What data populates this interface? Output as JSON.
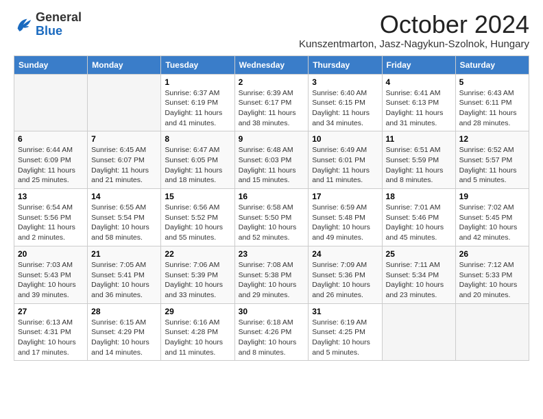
{
  "logo": {
    "general": "General",
    "blue": "Blue"
  },
  "header": {
    "title": "October 2024",
    "location": "Kunszentmarton, Jasz-Nagykun-Szolnok, Hungary"
  },
  "days_of_week": [
    "Sunday",
    "Monday",
    "Tuesday",
    "Wednesday",
    "Thursday",
    "Friday",
    "Saturday"
  ],
  "weeks": [
    [
      {
        "day": "",
        "info": ""
      },
      {
        "day": "",
        "info": ""
      },
      {
        "day": "1",
        "info": "Sunrise: 6:37 AM\nSunset: 6:19 PM\nDaylight: 11 hours and 41 minutes."
      },
      {
        "day": "2",
        "info": "Sunrise: 6:39 AM\nSunset: 6:17 PM\nDaylight: 11 hours and 38 minutes."
      },
      {
        "day": "3",
        "info": "Sunrise: 6:40 AM\nSunset: 6:15 PM\nDaylight: 11 hours and 34 minutes."
      },
      {
        "day": "4",
        "info": "Sunrise: 6:41 AM\nSunset: 6:13 PM\nDaylight: 11 hours and 31 minutes."
      },
      {
        "day": "5",
        "info": "Sunrise: 6:43 AM\nSunset: 6:11 PM\nDaylight: 11 hours and 28 minutes."
      }
    ],
    [
      {
        "day": "6",
        "info": "Sunrise: 6:44 AM\nSunset: 6:09 PM\nDaylight: 11 hours and 25 minutes."
      },
      {
        "day": "7",
        "info": "Sunrise: 6:45 AM\nSunset: 6:07 PM\nDaylight: 11 hours and 21 minutes."
      },
      {
        "day": "8",
        "info": "Sunrise: 6:47 AM\nSunset: 6:05 PM\nDaylight: 11 hours and 18 minutes."
      },
      {
        "day": "9",
        "info": "Sunrise: 6:48 AM\nSunset: 6:03 PM\nDaylight: 11 hours and 15 minutes."
      },
      {
        "day": "10",
        "info": "Sunrise: 6:49 AM\nSunset: 6:01 PM\nDaylight: 11 hours and 11 minutes."
      },
      {
        "day": "11",
        "info": "Sunrise: 6:51 AM\nSunset: 5:59 PM\nDaylight: 11 hours and 8 minutes."
      },
      {
        "day": "12",
        "info": "Sunrise: 6:52 AM\nSunset: 5:57 PM\nDaylight: 11 hours and 5 minutes."
      }
    ],
    [
      {
        "day": "13",
        "info": "Sunrise: 6:54 AM\nSunset: 5:56 PM\nDaylight: 11 hours and 2 minutes."
      },
      {
        "day": "14",
        "info": "Sunrise: 6:55 AM\nSunset: 5:54 PM\nDaylight: 10 hours and 58 minutes."
      },
      {
        "day": "15",
        "info": "Sunrise: 6:56 AM\nSunset: 5:52 PM\nDaylight: 10 hours and 55 minutes."
      },
      {
        "day": "16",
        "info": "Sunrise: 6:58 AM\nSunset: 5:50 PM\nDaylight: 10 hours and 52 minutes."
      },
      {
        "day": "17",
        "info": "Sunrise: 6:59 AM\nSunset: 5:48 PM\nDaylight: 10 hours and 49 minutes."
      },
      {
        "day": "18",
        "info": "Sunrise: 7:01 AM\nSunset: 5:46 PM\nDaylight: 10 hours and 45 minutes."
      },
      {
        "day": "19",
        "info": "Sunrise: 7:02 AM\nSunset: 5:45 PM\nDaylight: 10 hours and 42 minutes."
      }
    ],
    [
      {
        "day": "20",
        "info": "Sunrise: 7:03 AM\nSunset: 5:43 PM\nDaylight: 10 hours and 39 minutes."
      },
      {
        "day": "21",
        "info": "Sunrise: 7:05 AM\nSunset: 5:41 PM\nDaylight: 10 hours and 36 minutes."
      },
      {
        "day": "22",
        "info": "Sunrise: 7:06 AM\nSunset: 5:39 PM\nDaylight: 10 hours and 33 minutes."
      },
      {
        "day": "23",
        "info": "Sunrise: 7:08 AM\nSunset: 5:38 PM\nDaylight: 10 hours and 29 minutes."
      },
      {
        "day": "24",
        "info": "Sunrise: 7:09 AM\nSunset: 5:36 PM\nDaylight: 10 hours and 26 minutes."
      },
      {
        "day": "25",
        "info": "Sunrise: 7:11 AM\nSunset: 5:34 PM\nDaylight: 10 hours and 23 minutes."
      },
      {
        "day": "26",
        "info": "Sunrise: 7:12 AM\nSunset: 5:33 PM\nDaylight: 10 hours and 20 minutes."
      }
    ],
    [
      {
        "day": "27",
        "info": "Sunrise: 6:13 AM\nSunset: 4:31 PM\nDaylight: 10 hours and 17 minutes."
      },
      {
        "day": "28",
        "info": "Sunrise: 6:15 AM\nSunset: 4:29 PM\nDaylight: 10 hours and 14 minutes."
      },
      {
        "day": "29",
        "info": "Sunrise: 6:16 AM\nSunset: 4:28 PM\nDaylight: 10 hours and 11 minutes."
      },
      {
        "day": "30",
        "info": "Sunrise: 6:18 AM\nSunset: 4:26 PM\nDaylight: 10 hours and 8 minutes."
      },
      {
        "day": "31",
        "info": "Sunrise: 6:19 AM\nSunset: 4:25 PM\nDaylight: 10 hours and 5 minutes."
      },
      {
        "day": "",
        "info": ""
      },
      {
        "day": "",
        "info": ""
      }
    ]
  ]
}
